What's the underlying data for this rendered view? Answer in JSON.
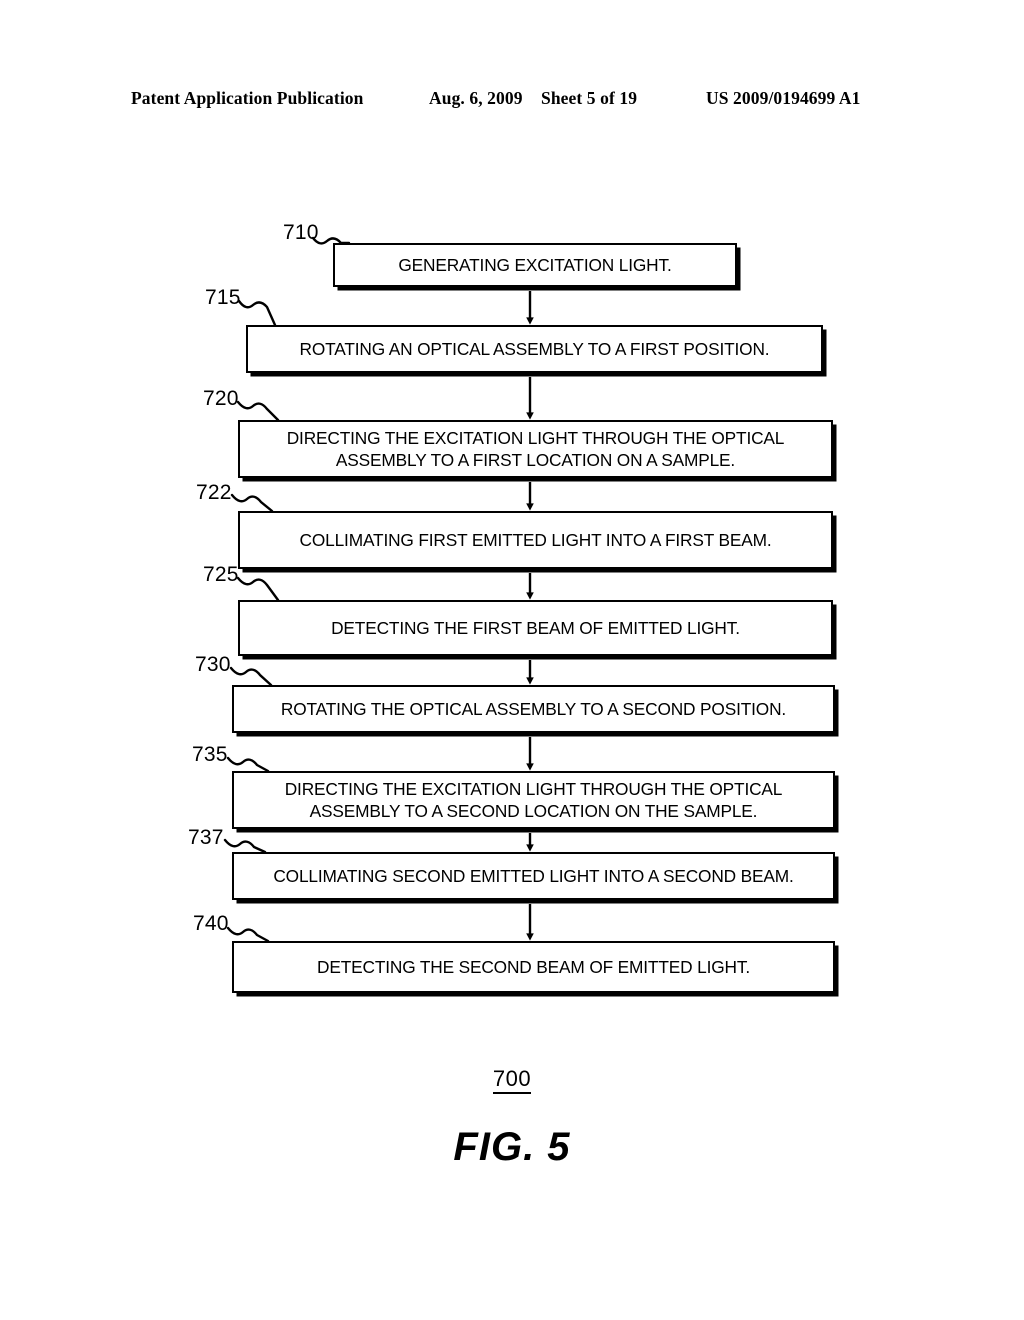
{
  "header": {
    "publication": "Patent Application Publication",
    "date": "Aug. 6, 2009",
    "sheet": "Sheet 5 of 19",
    "doc_number": "US 2009/0194699 A1"
  },
  "figure": {
    "number": "700",
    "label": "FIG. 5",
    "type": "flowchart"
  },
  "flowchart": {
    "steps": [
      {
        "ref": "710",
        "text": "GENERATING EXCITATION LIGHT."
      },
      {
        "ref": "715",
        "text": "ROTATING AN OPTICAL ASSEMBLY TO A FIRST POSITION."
      },
      {
        "ref": "720",
        "text": "DIRECTING THE EXCITATION LIGHT THROUGH THE OPTICAL\nASSEMBLY TO A FIRST LOCATION ON A SAMPLE."
      },
      {
        "ref": "722",
        "text": "COLLIMATING FIRST EMITTED LIGHT INTO A FIRST BEAM."
      },
      {
        "ref": "725",
        "text": "DETECTING THE FIRST BEAM OF EMITTED LIGHT."
      },
      {
        "ref": "730",
        "text": "ROTATING THE OPTICAL ASSEMBLY TO A SECOND POSITION."
      },
      {
        "ref": "735",
        "text": "DIRECTING THE EXCITATION LIGHT THROUGH THE OPTICAL\nASSEMBLY TO A SECOND LOCATION ON THE SAMPLE."
      },
      {
        "ref": "737",
        "text": "COLLIMATING SECOND EMITTED LIGHT INTO A SECOND BEAM."
      },
      {
        "ref": "740",
        "text": "DETECTING THE SECOND BEAM OF EMITTED LIGHT."
      }
    ]
  },
  "colors": {
    "ink": "#000000",
    "page": "#ffffff"
  }
}
